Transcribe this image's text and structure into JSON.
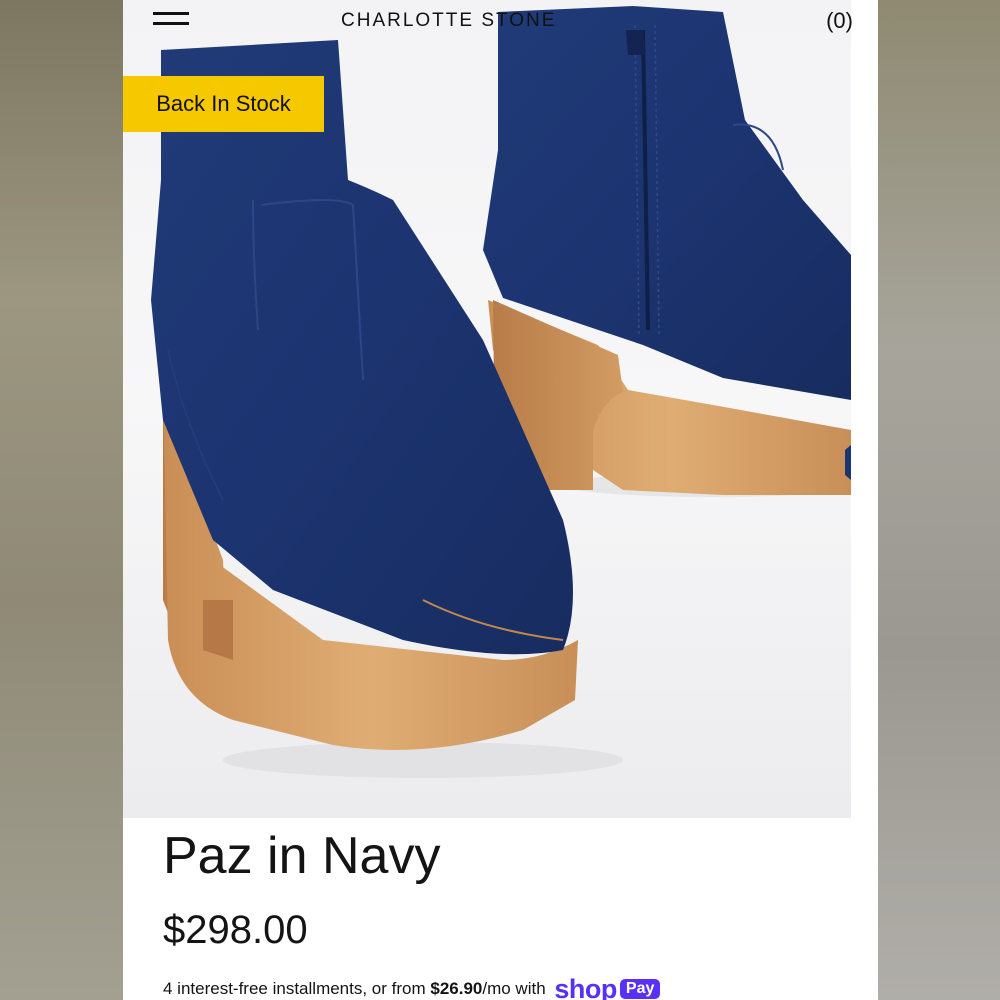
{
  "header": {
    "brand": "CHARLOTTE STONE",
    "cart_count": "(0)",
    "menu_icon": "hamburger-menu-icon"
  },
  "product": {
    "badge": "Back In Stock",
    "name": "Paz in Navy",
    "price": "$298.00",
    "installments_prefix": "4 interest-free installments, or from ",
    "installment_amount": "$26.90",
    "installments_suffix": "/mo with",
    "shop_pay_brand": "shop",
    "shop_pay_pill": "Pay"
  },
  "colors": {
    "badge": "#f6c800",
    "shop_pay": "#5a31f4",
    "suede_navy": "#1f3a78",
    "wood": "#d6a066"
  }
}
